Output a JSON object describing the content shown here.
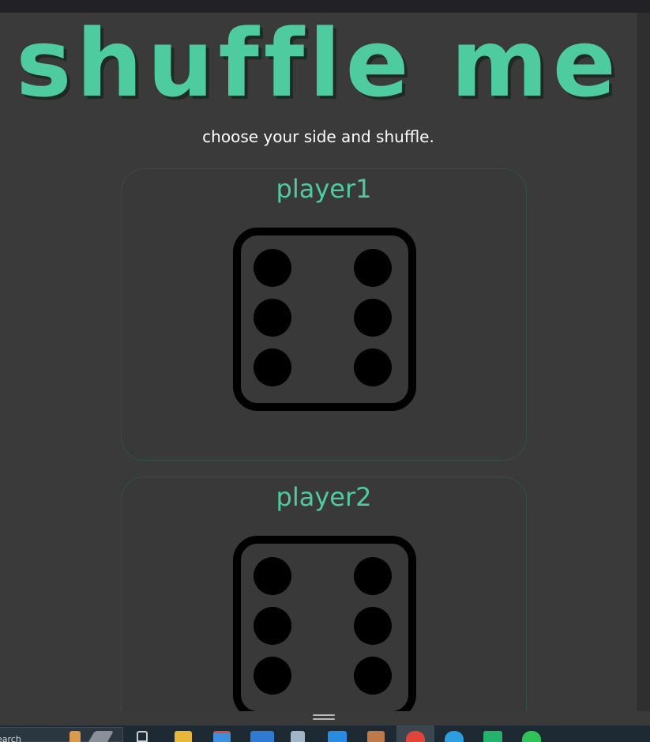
{
  "title": "shuffle me",
  "subtitle": "choose your side and shuffle.",
  "players": [
    {
      "name": "player1",
      "die_value": 6
    },
    {
      "name": "player2",
      "die_value": 6
    }
  ],
  "taskbar": {
    "search_placeholder": "earch",
    "apps": [
      "widgets-icon",
      "pen-icon",
      "task-view-icon",
      "file-explorer-icon",
      "store-icon",
      "mail-icon",
      "notepad-icon",
      "vscode-icon",
      "paint-icon",
      "chrome-icon",
      "telegram-icon",
      "chat-icon",
      "whatsapp-icon"
    ]
  },
  "colors": {
    "accent": "#4ecb9f",
    "background": "#3a3a3a",
    "text": "#ffffff",
    "card_border": "#2e5245",
    "die": "#000000"
  }
}
